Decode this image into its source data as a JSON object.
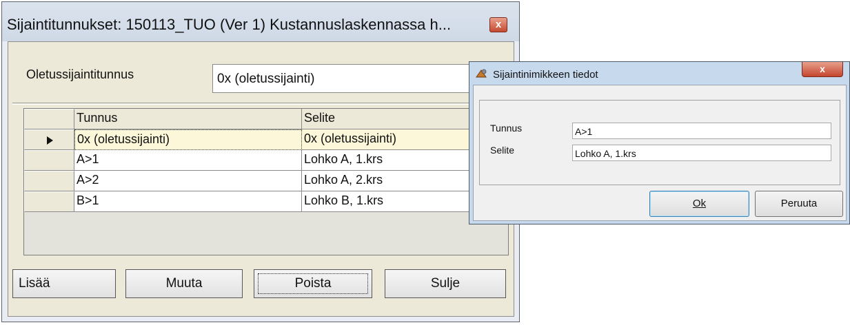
{
  "main_window": {
    "title": "Sijaintitunnukset: 150113_TUO (Ver 1) Kustannuslaskennassa h...",
    "close_label": "x",
    "default_label": "Oletussijaintitunnus",
    "default_value": "0x (oletussijainti)",
    "grid": {
      "headers": [
        "Tunnus",
        "Selite"
      ],
      "rows": [
        {
          "tunnus": "0x (oletussijainti)",
          "selite": "0x (oletussijainti)",
          "selected": true
        },
        {
          "tunnus": "A>1",
          "selite": "Lohko A, 1.krs",
          "selected": false
        },
        {
          "tunnus": "A>2",
          "selite": "Lohko A, 2.krs",
          "selected": false
        },
        {
          "tunnus": "B>1",
          "selite": "Lohko B, 1.krs",
          "selected": false
        }
      ]
    },
    "buttons": {
      "add": "Lisää",
      "edit": "Muuta",
      "delete": "Poista",
      "close": "Sulje"
    }
  },
  "dialog": {
    "title": "Sijaintinimikkeen tiedot",
    "close_label": "x",
    "tunnus_label": "Tunnus",
    "tunnus_value": "A>1",
    "selite_label": "Selite",
    "selite_value": "Lohko A, 1.krs",
    "ok_label": "Ok",
    "cancel_label": "Peruuta"
  }
}
